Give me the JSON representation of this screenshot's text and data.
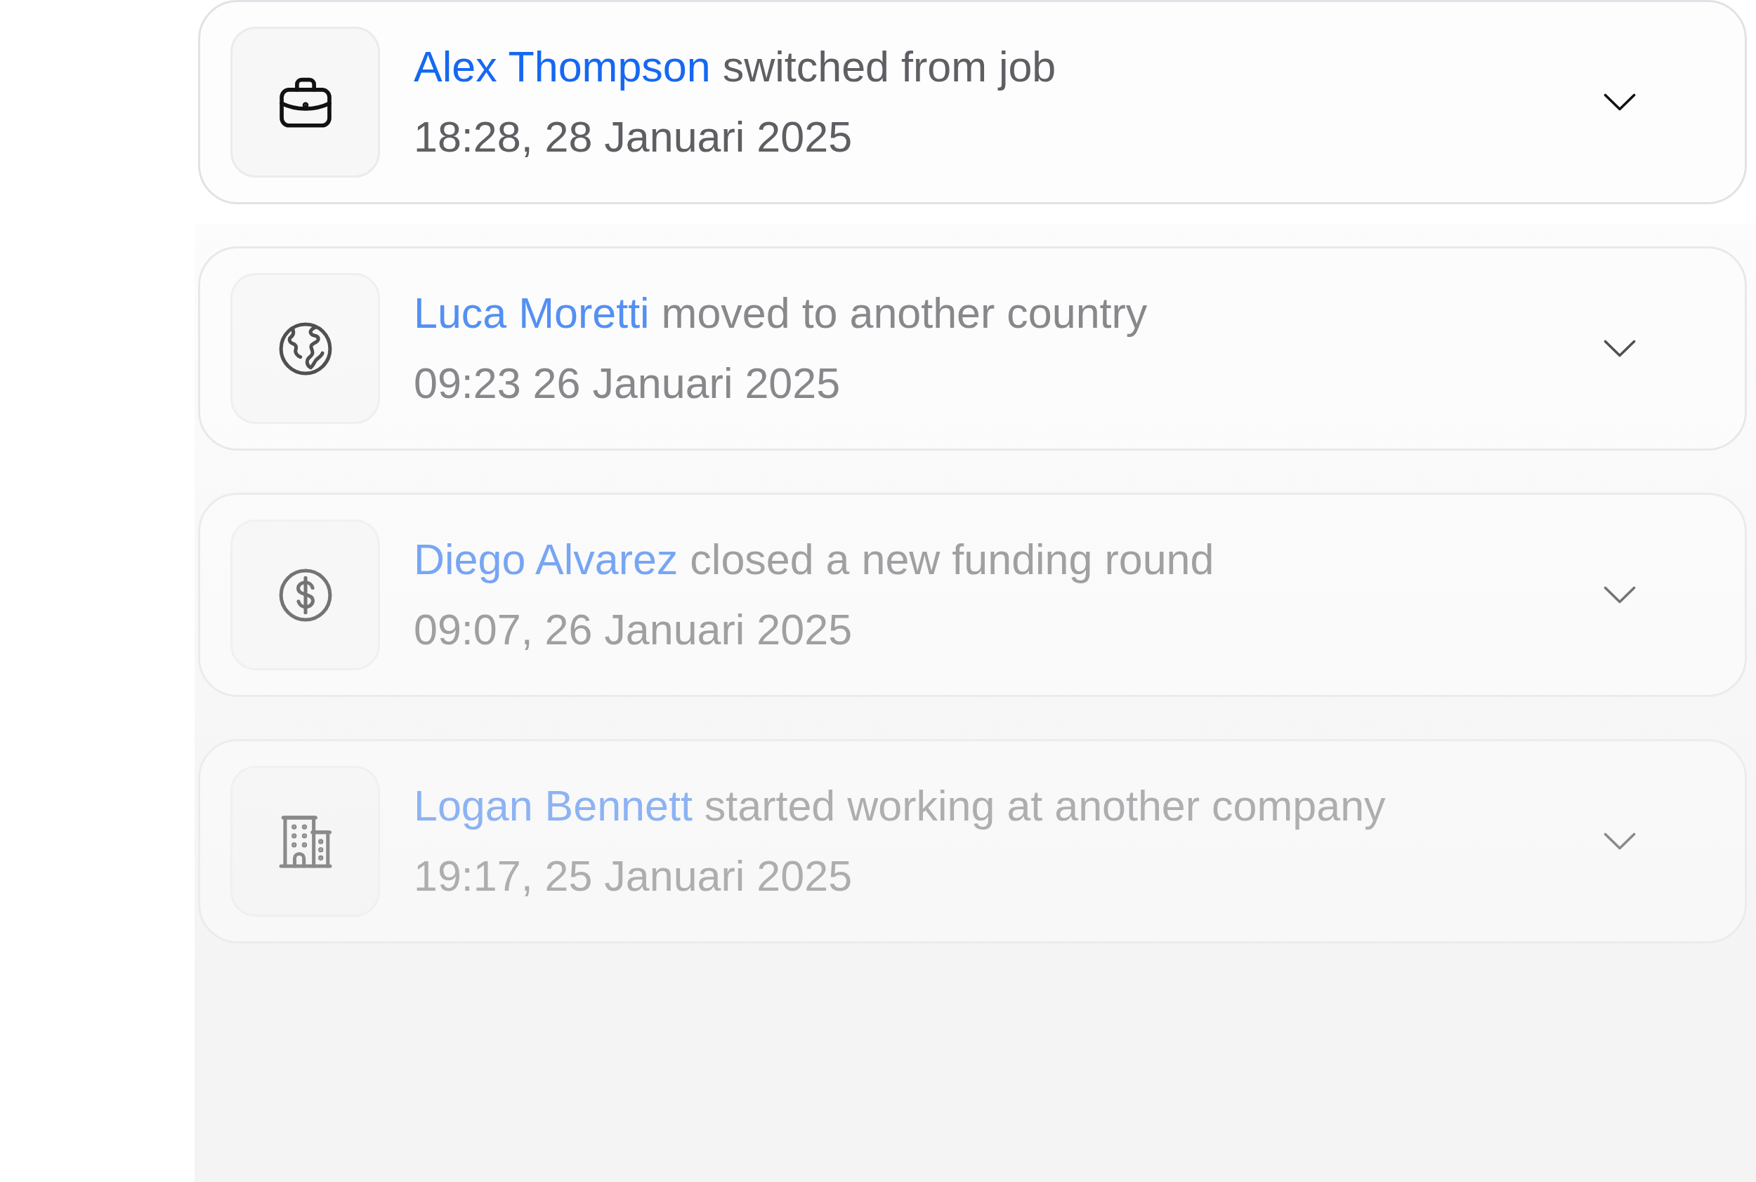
{
  "events": [
    {
      "kind": "job",
      "name": "Alex Thompson",
      "action": "switched from job",
      "time": "18:28, 28 Januari 2025"
    },
    {
      "kind": "move",
      "name": "Luca Moretti",
      "action": "moved to another country",
      "time": "09:23 26 Januari 2025"
    },
    {
      "kind": "funding",
      "name": "Diego Alvarez",
      "action": "closed a new funding round",
      "time": "09:07, 26 Januari 2025"
    },
    {
      "kind": "company",
      "name": "Logan Bennett",
      "action": "started working at another company",
      "time": "19:17, 25 Januari 2025"
    }
  ]
}
